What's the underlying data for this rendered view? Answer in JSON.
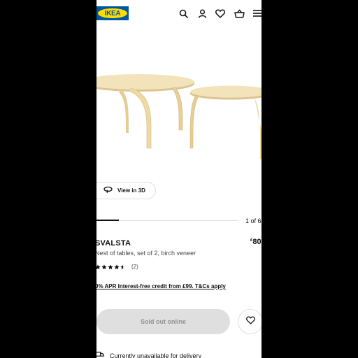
{
  "header": {
    "logo_text": "IKEA",
    "icons": [
      "search-icon",
      "account-icon",
      "heart-icon",
      "basket-icon",
      "menu-icon"
    ]
  },
  "gallery": {
    "view_3d_label": "View in 3D",
    "counter": "1 of 6",
    "current_slide": 1,
    "total_slides": 6
  },
  "product": {
    "name": "SVALSTA",
    "description": "Nest of tables, set of 2, birch veneer",
    "price_currency": "£",
    "price_value": "80",
    "rating_value": 4.5,
    "rating_max": 5,
    "review_count": "(2)",
    "credit_text": "0% APR Interest-free credit from £99. T&Cs apply"
  },
  "actions": {
    "sold_out_label": "Sold out online",
    "delivery_text": "Currently unavailable for delivery"
  },
  "colors": {
    "ikea_blue": "#0058a3",
    "ikea_yellow": "#ffdb00",
    "birch": "#efd9a6",
    "disabled_button": "#dfdfdf",
    "disabled_text": "#929292"
  }
}
